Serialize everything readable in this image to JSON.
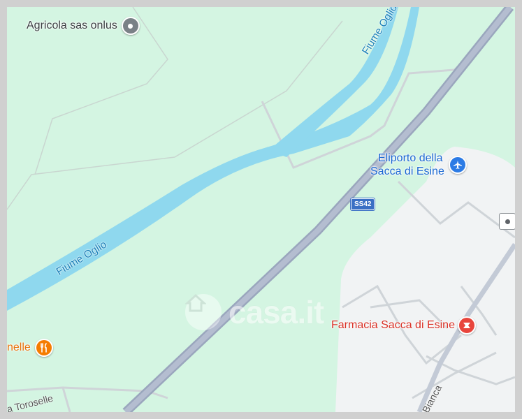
{
  "map": {
    "colors": {
      "land": "#d4f5e2",
      "urban": "#f1f3f4",
      "river": "#8fd8ee",
      "highway": "#aab4c8",
      "local_road": "#d1d5da",
      "frame": "#d0d0d0"
    },
    "pois": {
      "agricola": {
        "label": "Agricola sas onlus",
        "icon": "generic-pin-icon"
      },
      "eliporto": {
        "line1": "Eliporto della",
        "line2": "Sacca di Esine",
        "icon": "airport-icon"
      },
      "farmacia": {
        "label": "Farmacia Sacca di Esine",
        "icon": "pharmacy-icon"
      },
      "restaurant": {
        "label": "nelle",
        "icon": "restaurant-icon"
      }
    },
    "labels": {
      "river_top": "Fiume Oglio",
      "river_mid": "Fiume Oglio",
      "road_sw": "a Toroselle",
      "road_se": "Bianca",
      "highway_shield": "SS42"
    },
    "watermark": "casa.it"
  }
}
